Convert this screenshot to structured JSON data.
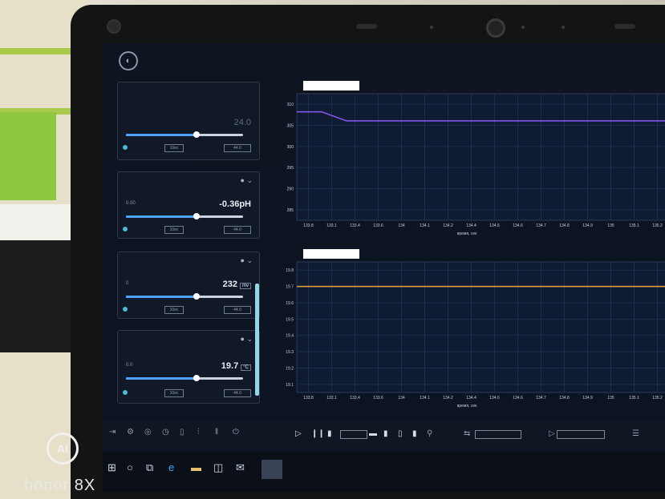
{
  "panels": [
    {
      "value": "24.0",
      "unit": "",
      "button": "10ec",
      "box": "44.0"
    },
    {
      "label": "0.00",
      "value": "-0.36",
      "unit": "pH",
      "button": "10ec",
      "box": "44.0"
    },
    {
      "label": "0",
      "value": "232",
      "unit": "mv",
      "button": "10ec",
      "box": "44.0"
    },
    {
      "label": "0.0",
      "value": "19.7",
      "unit": "°C",
      "button": "10ec",
      "box": "44.0"
    }
  ],
  "levels": {
    "panel0": 0.6,
    "panel1": 0.6,
    "panel2": 0.6,
    "panel3": 0.6
  },
  "colors": {
    "screen_bg": "#0e1420",
    "line1": "#8a5cf5",
    "line2": "#e8a33a",
    "accent": "#4da3ff"
  },
  "chart_data": [
    {
      "type": "line",
      "y_ticks": [
        "310",
        "305",
        "300",
        "295",
        "290",
        "285"
      ],
      "x_ticks": [
        "133.8",
        "133.1",
        "133.4",
        "133.6",
        "134",
        "134.1",
        "134.2",
        "134.4",
        "134.6",
        "134.6",
        "134.7",
        "134.8",
        "134.9",
        "135",
        "135.1",
        "135.2"
      ],
      "xlabel": "время, сек",
      "series": [
        {
          "values": [
            307,
            307,
            305,
            305,
            305,
            305,
            305,
            305,
            305,
            305,
            305,
            305,
            305,
            305,
            305,
            305
          ]
        }
      ],
      "grid": true
    },
    {
      "type": "line",
      "y_ticks": [
        "19.8",
        "19.7",
        "19.6",
        "19.5",
        "19.4",
        "19.3",
        "19.2",
        "19.1"
      ],
      "x_ticks": [
        "133.8",
        "133.1",
        "133.4",
        "133.6",
        "134",
        "134.1",
        "134.2",
        "134.4",
        "134.6",
        "134.6",
        "134.7",
        "134.8",
        "134.9",
        "135",
        "135.1",
        "135.2"
      ],
      "xlabel": "время, сек",
      "series": [
        {
          "values": [
            19.7,
            19.7,
            19.7,
            19.7,
            19.7,
            19.7,
            19.7,
            19.7,
            19.7,
            19.7,
            19.7,
            19.7,
            19.7,
            19.7,
            19.7,
            19.7
          ]
        }
      ],
      "grid": true
    }
  ],
  "watermark": {
    "brand": "honor 8X",
    "badge": "AI"
  }
}
